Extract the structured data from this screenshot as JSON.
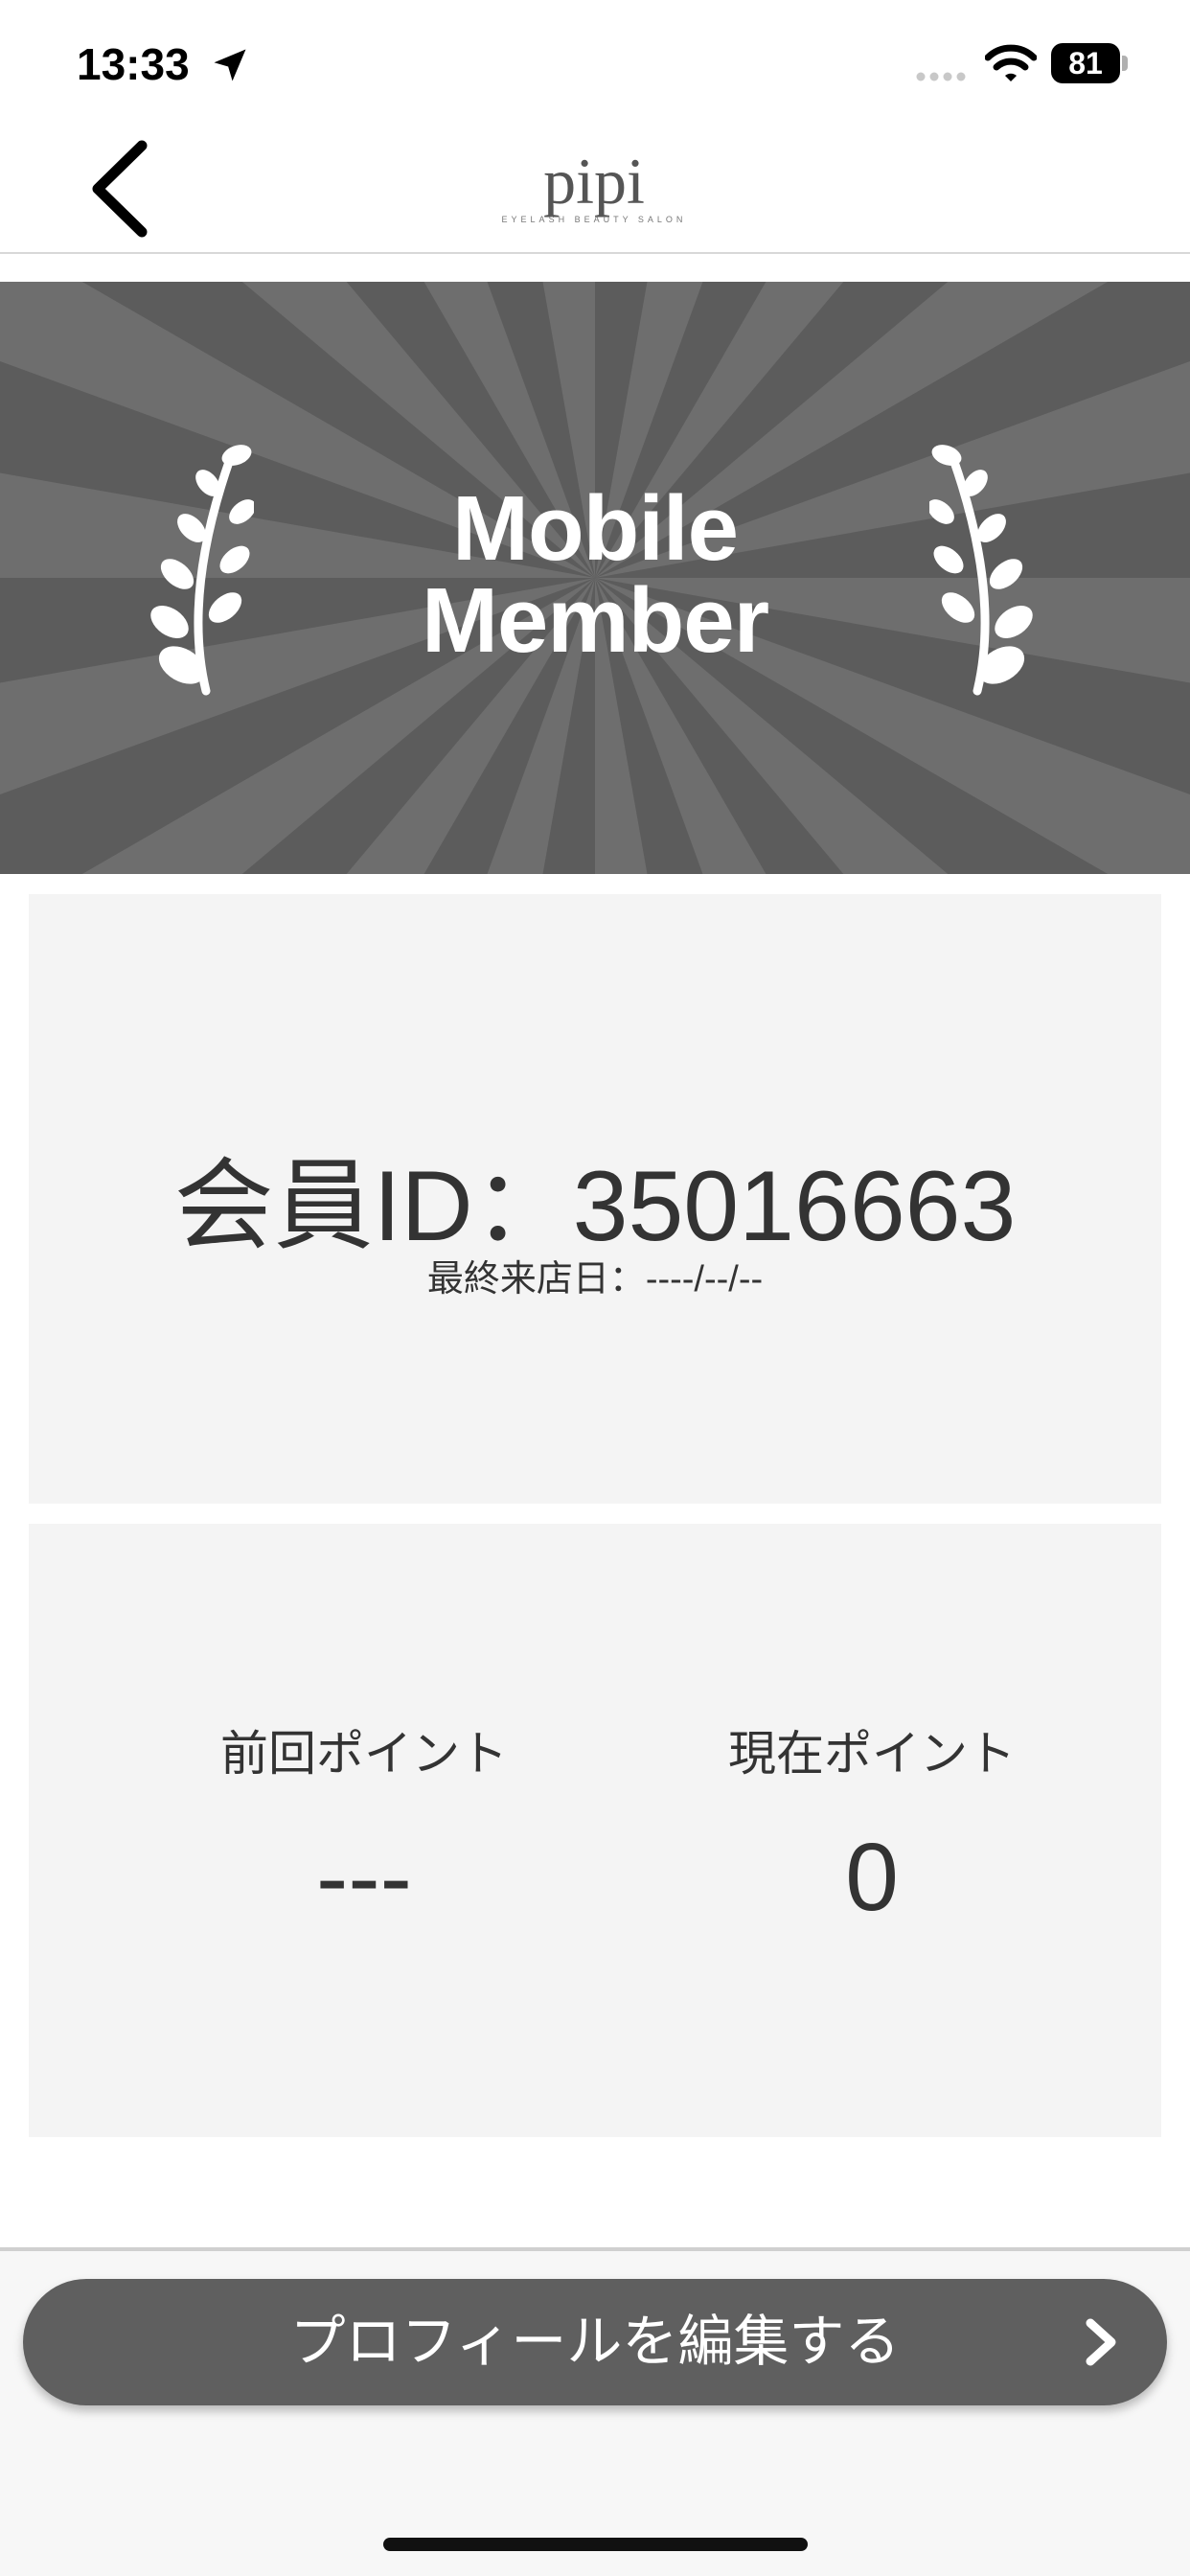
{
  "status_bar": {
    "time": "13:33",
    "battery": "81",
    "icons": [
      "location-arrow-icon",
      "cellular-signal-icon",
      "wifi-icon",
      "battery-icon"
    ]
  },
  "nav": {
    "back_icon": "chevron-left-icon",
    "logo_text": "pipi",
    "logo_subtext": "EYELASH BEAUTY SALON"
  },
  "hero": {
    "title_line1": "Mobile",
    "title_line2": "Member",
    "decor_icon": "laurel-branch-icon"
  },
  "member": {
    "id_label": "会員ID：35016663",
    "last_visit": "最終来店日：----/--/--"
  },
  "points": {
    "previous_label": "前回ポイント",
    "previous_value": "---",
    "current_label": "現在ポイント",
    "current_value": "0"
  },
  "footer": {
    "edit_profile_label": "プロフィールを編集する",
    "chevron_icon": "chevron-right-icon"
  },
  "colors": {
    "hero_bg": "#5c5c5c",
    "hero_ray": "#6e6e6e",
    "card_bg": "#f4f4f4",
    "button_bg": "#5f5f5f",
    "text": "#333333"
  }
}
